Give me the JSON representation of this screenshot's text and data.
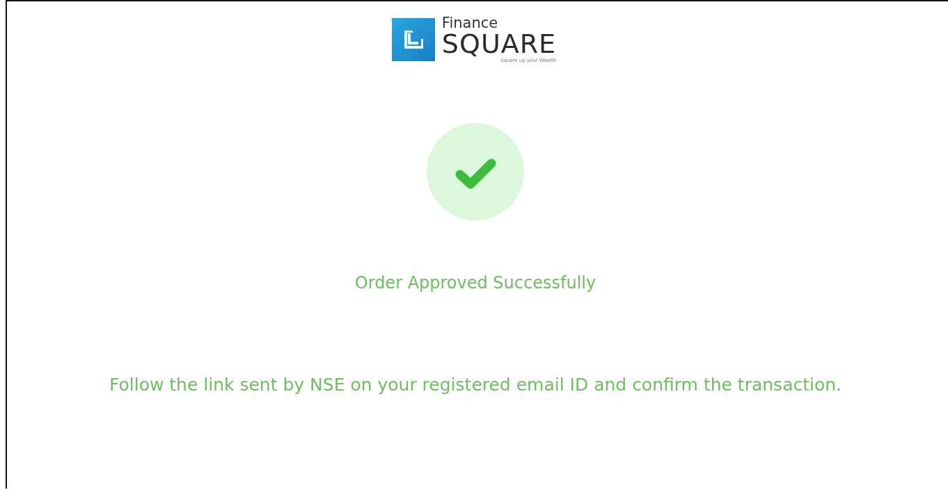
{
  "logo": {
    "line_1": "Finance",
    "line_2": "SQUARE",
    "tagline": "Square up your Wealth"
  },
  "status": {
    "title": "Order Approved Successfully",
    "message": "Follow the link sent by NSE on your registered email ID and confirm the transaction."
  }
}
